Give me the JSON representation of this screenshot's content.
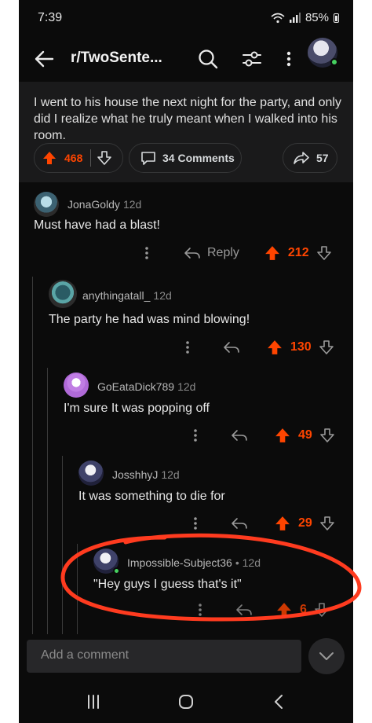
{
  "status_bar": {
    "time": "7:39",
    "battery": "85%"
  },
  "header": {
    "title": "r/TwoSente..."
  },
  "post": {
    "text": "I went to his house the next night for the party, and only did I realize what he truly meant when I walked into his room.",
    "votes": "468",
    "comments_label": "34 Comments",
    "shares": "57"
  },
  "comments": [
    {
      "user": "JonaGoldy",
      "age": "12d",
      "text": "Must have had a blast!",
      "reply_label": "Reply",
      "score": "212"
    },
    {
      "user": "anythingatall_",
      "age": "12d",
      "text": "The party he had was mind blowing!",
      "score": "130"
    },
    {
      "user": "GoEataDick789",
      "age": "12d",
      "text": "I'm sure It was popping off",
      "score": "49"
    },
    {
      "user": "JosshhyJ",
      "age": "12d",
      "text": "It was something to die for",
      "score": "29"
    },
    {
      "user": "Impossible-Subject36",
      "age": "• 12d",
      "text": "\"Hey guys I guess that's it\"",
      "score": "6"
    }
  ],
  "composer": {
    "placeholder": "Add a comment"
  },
  "colors": {
    "accent": "#ff4500",
    "annotation": "#ff3b1f",
    "background": "#0b0b0b",
    "online": "#46d160"
  },
  "icons": [
    "back-arrow-icon",
    "search-icon",
    "filter-icon",
    "more-vertical-icon",
    "upvote-icon",
    "downvote-icon",
    "comment-icon",
    "share-icon",
    "reply-icon",
    "chevron-down-icon",
    "nav-recents-icon",
    "nav-home-icon",
    "nav-back-icon"
  ]
}
